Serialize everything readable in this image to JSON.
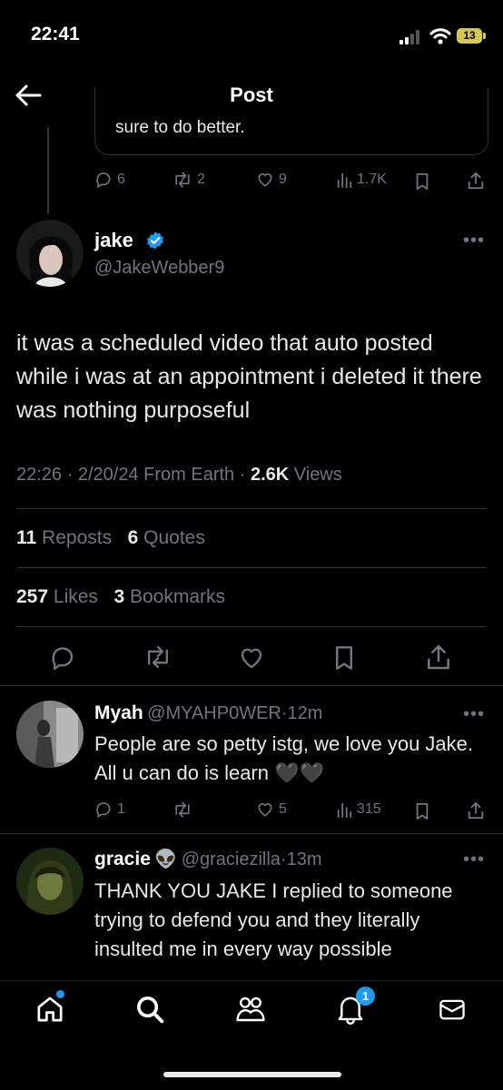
{
  "status_bar": {
    "time": "22:41",
    "battery": "13"
  },
  "header": {
    "title": "Post"
  },
  "parent_tweet": {
    "text_fragment": "sure to do better.",
    "replies": "6",
    "reposts": "2",
    "likes": "9",
    "views": "1.7K"
  },
  "main_tweet": {
    "author_name": "jake",
    "author_handle": "@JakeWebber9",
    "text": "it was a scheduled video that auto posted while i was at an appointment i deleted it there was nothing purposeful",
    "time": "22:26",
    "date": "2/20/24",
    "source": "From Earth",
    "views_count": "2.6K",
    "views_label": "Views",
    "reposts_count": "11",
    "reposts_label": "Reposts",
    "quotes_count": "6",
    "quotes_label": "Quotes",
    "likes_count": "257",
    "likes_label": "Likes",
    "bookmarks_count": "3",
    "bookmarks_label": "Bookmarks"
  },
  "replies": [
    {
      "name": "Myah",
      "handle": "@MYAHP0WER",
      "time": "12m",
      "text": "People are so petty istg, we love you Jake. All u can do is learn 🖤🖤",
      "replies": "1",
      "reposts": "",
      "likes": "5",
      "views": "315"
    },
    {
      "name": "gracie",
      "emoji": "👽",
      "handle": "@graciezilla",
      "time": "13m",
      "text": "THANK YOU JAKE I replied to someone trying to defend you and they literally insulted me in every way possible"
    }
  ],
  "nav": {
    "notifications_badge": "1"
  },
  "colors": {
    "accent": "#1d9bf0",
    "background": "#000000",
    "muted": "#71767b",
    "battery": "#d6c84a"
  }
}
